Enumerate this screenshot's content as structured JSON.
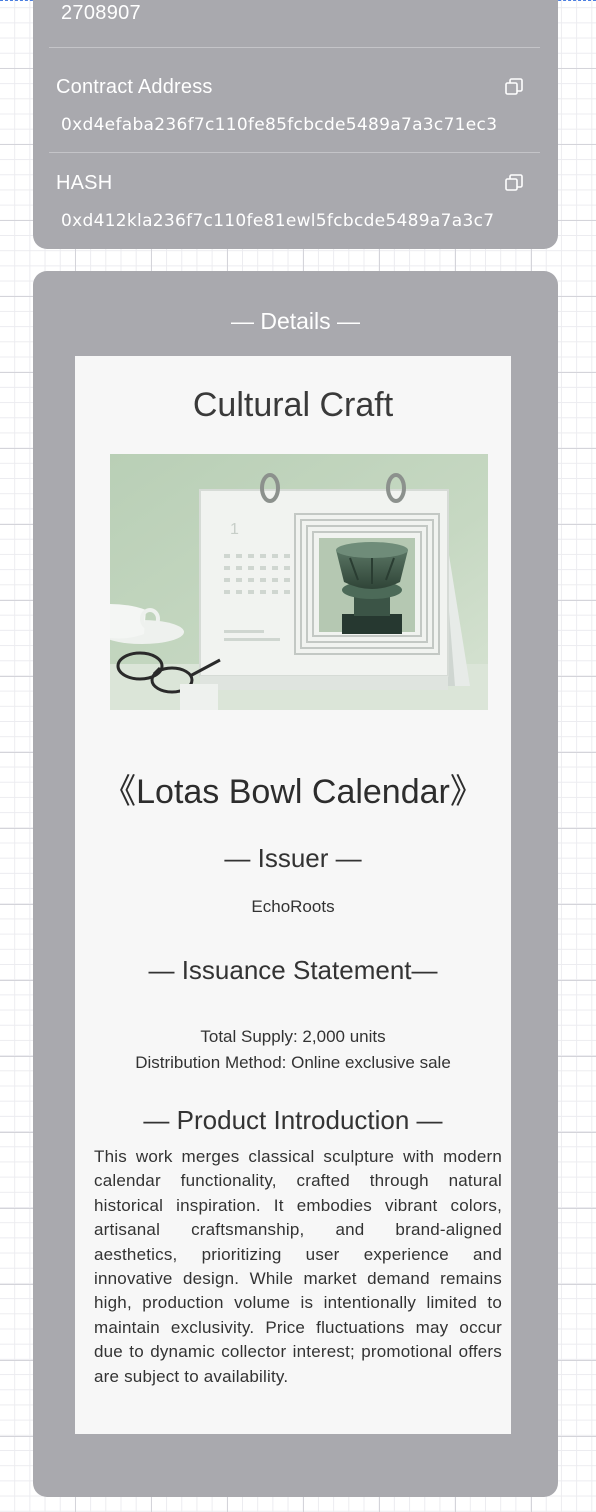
{
  "info": {
    "block_number": "2708907",
    "contract_address": {
      "label": "Contract Address",
      "value": "0xd4efaba236f7c110fe85fcbcde5489a7a3c71ec3"
    },
    "hash": {
      "label": "HASH",
      "value": "0xd412kla236f7c110fe81ewl5fcbcde5489a7a3c7"
    }
  },
  "details": {
    "heading": "— Details —",
    "title": "Cultural Craft",
    "product_name": "《Lotas Bowl Calendar》",
    "issuer": {
      "heading": "— Issuer —",
      "name": "EchoRoots"
    },
    "issuance_statement": {
      "heading": "— Issuance Statement—",
      "total_supply": "Total Supply: 2,000 units",
      "distribution": "Distribution Method: Online exclusive sale"
    },
    "product_introduction": {
      "heading": "— Product Introduction —",
      "text": "This work merges classical sculpture with modern calendar functionality, crafted through natural historical inspiration. It embodies vibrant colors, artisanal craftsmanship, and brand-aligned aesthetics, prioritizing user experience and innovative design. While market demand remains high, production volume is intentionally limited to maintain exclusivity. Price fluctuations may occur due to dynamic collector interest; promotional offers are subject to availability."
    }
  },
  "colors": {
    "card_background": "#a9a9ae",
    "certificate_background": "#f7f7f7",
    "text_dark": "#333333",
    "text_light": "#ffffff"
  },
  "icons": [
    "copy-icon"
  ]
}
